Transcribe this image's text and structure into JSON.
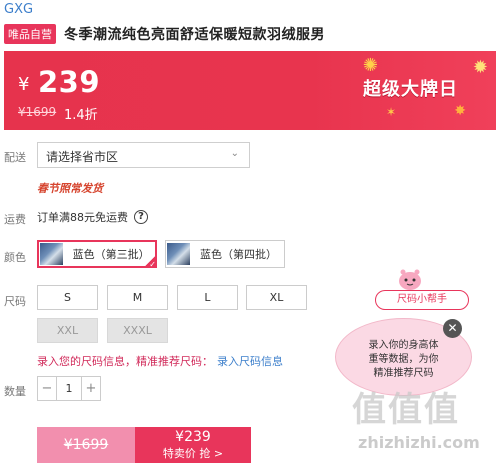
{
  "brand": "GXG",
  "shop_tag": "唯品自营",
  "title": "冬季潮流纯色亮面舒适保暖短款羽绒服男",
  "price": {
    "currency": "¥",
    "value": "239",
    "original": "¥1699",
    "discount": "1.4折"
  },
  "festival_badge": "超级大牌日",
  "delivery": {
    "label": "配送",
    "placeholder": "请选择省市区",
    "festival_ship": "春节照常发货"
  },
  "freight": {
    "label": "运费",
    "text": "订单满88元免运费"
  },
  "colors": {
    "label": "颜色",
    "options": [
      "蓝色（第三批）",
      "蓝色（第四批）"
    ],
    "selected": "蓝色（第三批）"
  },
  "sizes": {
    "label": "尺码",
    "options": [
      "S",
      "M",
      "L",
      "XL",
      "XXL",
      "XXXL"
    ],
    "disabled": [
      "XXL",
      "XXXL"
    ],
    "hint": "录入您的尺码信息，精准推荐尺码：",
    "hint_link": "录入尺码信息"
  },
  "quantity": {
    "label": "数量",
    "value": "1",
    "minus": "−",
    "plus": "+"
  },
  "buy": {
    "original": "¥1699",
    "price": "¥239",
    "cta": "特卖价 抢 >"
  },
  "size_helper": {
    "pill": "尺码小帮手",
    "bubble_lines": [
      "录入你的身高体",
      "重等数据，为你",
      "精准推荐尺码"
    ]
  },
  "watermark": {
    "text": "值值值",
    "url": "zhizhizhi.com"
  },
  "colors_theme": {
    "accent": "#e8355b",
    "link": "#3d7fcb",
    "banner": "#e6334d"
  }
}
